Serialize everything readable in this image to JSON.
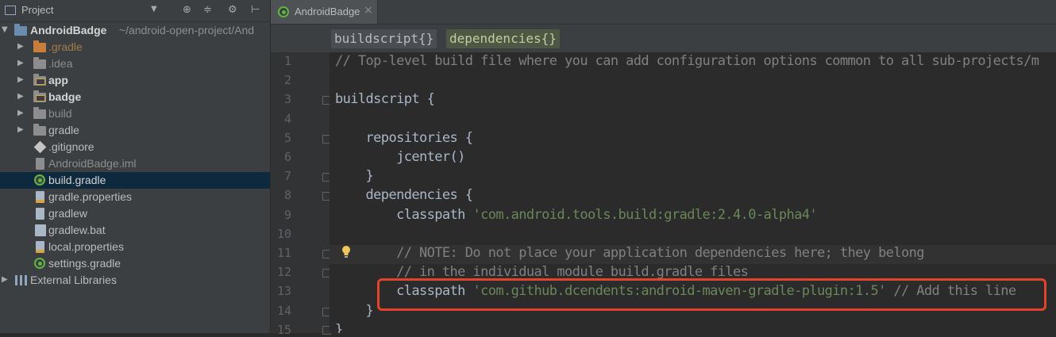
{
  "project_panel": {
    "title": "Project",
    "tools": [
      "⊕",
      "≑",
      "⚙",
      "⊢"
    ],
    "root": {
      "name": "AndroidBadge",
      "path": "~/android-open-project/And"
    },
    "items": [
      {
        "label": ".gradle",
        "kind": "folder-orange",
        "expandable": true
      },
      {
        "label": ".idea",
        "kind": "folder",
        "expandable": true
      },
      {
        "label": "app",
        "kind": "module",
        "expandable": true
      },
      {
        "label": "badge",
        "kind": "module",
        "expandable": true
      },
      {
        "label": "build",
        "kind": "folder",
        "expandable": true
      },
      {
        "label": "gradle",
        "kind": "folder",
        "expandable": true
      },
      {
        "label": ".gitignore",
        "kind": "git",
        "expandable": false
      },
      {
        "label": "AndroidBadge.iml",
        "kind": "iml",
        "expandable": false
      },
      {
        "label": "build.gradle",
        "kind": "gradle",
        "expandable": false,
        "selected": true
      },
      {
        "label": "gradle.properties",
        "kind": "props",
        "expandable": false
      },
      {
        "label": "gradlew",
        "kind": "file",
        "expandable": false
      },
      {
        "label": "gradlew.bat",
        "kind": "bat",
        "expandable": false
      },
      {
        "label": "local.properties",
        "kind": "props",
        "expandable": false
      },
      {
        "label": "settings.gradle",
        "kind": "gradle",
        "expandable": false
      }
    ],
    "external": "External Libraries"
  },
  "editor": {
    "tab_label": "AndroidBadge",
    "tab_close": "×",
    "breadcrumbs": [
      "buildscript{}",
      "dependencies{}"
    ],
    "line_numbers": [
      "1",
      "2",
      "3",
      "4",
      "5",
      "6",
      "7",
      "8",
      "9",
      "10",
      "11",
      "12",
      "13",
      "14",
      "15"
    ],
    "lines": {
      "l1": "// Top-level build file where you can add configuration options common to all sub-projects/m",
      "l3": "buildscript {",
      "l5": "    repositories {",
      "l6": "        jcenter()",
      "l7": "    }",
      "l8": "    dependencies {",
      "l9_a": "        classpath ",
      "l9_b": "'com.android.tools.build:gradle:2.4.0-alpha4'",
      "l11": "        // NOTE: Do not place your application dependencies here; they belong",
      "l12": "        // in the individual module build.gradle files",
      "l13_a": "        classpath ",
      "l13_b": "'com.github.dcendents:android-maven-gradle-plugin:1.5'",
      "l13_c": " // Add this line",
      "l14": "    }",
      "l15": "}"
    }
  },
  "colors": {
    "highlight_box": "#e0452b",
    "selection": "#0d293e",
    "string": "#6a8759",
    "comment": "#808080"
  }
}
